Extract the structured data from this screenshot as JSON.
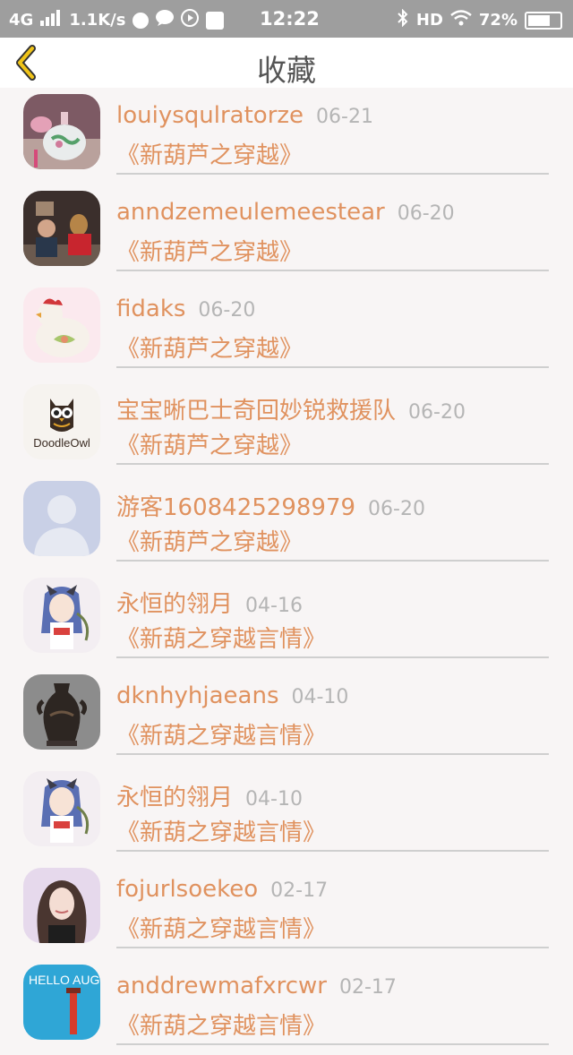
{
  "status_bar": {
    "network": "4G",
    "speed": "1.1K/s",
    "time": "12:22",
    "hd": "HD",
    "battery": "72%",
    "battery_level": 0.72,
    "icons": [
      "signal-icon",
      "app-icon",
      "message-icon",
      "play-icon",
      "app-square-icon",
      "bluetooth-icon",
      "wifi-icon",
      "battery-icon"
    ]
  },
  "header": {
    "title": "收藏",
    "back_icon": "chevron-left-icon",
    "accent_color": "#f0c419"
  },
  "colors": {
    "name": "#e0925f",
    "date": "#b5b5b5",
    "divider": "#cfcfcf"
  },
  "favorites": [
    {
      "user": "louiysqulratorze",
      "date": "06-21",
      "book": "《新葫芦之穿越》",
      "avatar": "perfume-bottle"
    },
    {
      "user": "anndzemeulemeestear",
      "date": "06-20",
      "book": "《新葫芦之穿越》",
      "avatar": "child-with-dog"
    },
    {
      "user": "fidaks",
      "date": "06-20",
      "book": "《新葫芦之穿越》",
      "avatar": "ceramic-chicken"
    },
    {
      "user": "宝宝晰巴士奇回妙锐救援队",
      "date": "06-20",
      "book": "《新葫芦之穿越》",
      "avatar": "doodle-owl-logo",
      "avatar_text": "DoodleOwl"
    },
    {
      "user": "游客1608425298979",
      "date": "06-20",
      "book": "《新葫芦之穿越》",
      "avatar": "default-user"
    },
    {
      "user": "永恒的翎月",
      "date": "04-16",
      "book": "《新葫之穿越言情》",
      "avatar": "anime-girl"
    },
    {
      "user": "dknhyhjaeans",
      "date": "04-10",
      "book": "《新葫之穿越言情》",
      "avatar": "bronze-vase"
    },
    {
      "user": "永恒的翎月",
      "date": "04-10",
      "book": "《新葫之穿越言情》",
      "avatar": "anime-girl"
    },
    {
      "user": "fojurlsoekeo",
      "date": "02-17",
      "book": "《新葫之穿越言情》",
      "avatar": "woman-portrait"
    },
    {
      "user": "anddrewmafxrcwr",
      "date": "02-17",
      "book": "《新葫之穿越言情》",
      "avatar": "hello-august",
      "avatar_text": "HELLO AUGUST"
    }
  ]
}
